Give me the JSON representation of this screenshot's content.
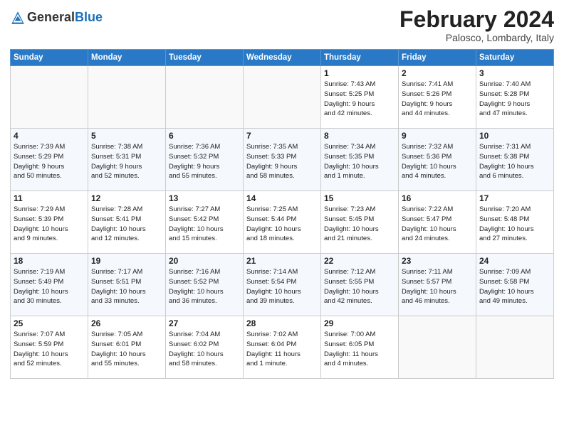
{
  "logo": {
    "general": "General",
    "blue": "Blue"
  },
  "header": {
    "month": "February 2024",
    "location": "Palosco, Lombardy, Italy"
  },
  "weekdays": [
    "Sunday",
    "Monday",
    "Tuesday",
    "Wednesday",
    "Thursday",
    "Friday",
    "Saturday"
  ],
  "weeks": [
    [
      {
        "day": "",
        "info": ""
      },
      {
        "day": "",
        "info": ""
      },
      {
        "day": "",
        "info": ""
      },
      {
        "day": "",
        "info": ""
      },
      {
        "day": "1",
        "info": "Sunrise: 7:43 AM\nSunset: 5:25 PM\nDaylight: 9 hours\nand 42 minutes."
      },
      {
        "day": "2",
        "info": "Sunrise: 7:41 AM\nSunset: 5:26 PM\nDaylight: 9 hours\nand 44 minutes."
      },
      {
        "day": "3",
        "info": "Sunrise: 7:40 AM\nSunset: 5:28 PM\nDaylight: 9 hours\nand 47 minutes."
      }
    ],
    [
      {
        "day": "4",
        "info": "Sunrise: 7:39 AM\nSunset: 5:29 PM\nDaylight: 9 hours\nand 50 minutes."
      },
      {
        "day": "5",
        "info": "Sunrise: 7:38 AM\nSunset: 5:31 PM\nDaylight: 9 hours\nand 52 minutes."
      },
      {
        "day": "6",
        "info": "Sunrise: 7:36 AM\nSunset: 5:32 PM\nDaylight: 9 hours\nand 55 minutes."
      },
      {
        "day": "7",
        "info": "Sunrise: 7:35 AM\nSunset: 5:33 PM\nDaylight: 9 hours\nand 58 minutes."
      },
      {
        "day": "8",
        "info": "Sunrise: 7:34 AM\nSunset: 5:35 PM\nDaylight: 10 hours\nand 1 minute."
      },
      {
        "day": "9",
        "info": "Sunrise: 7:32 AM\nSunset: 5:36 PM\nDaylight: 10 hours\nand 4 minutes."
      },
      {
        "day": "10",
        "info": "Sunrise: 7:31 AM\nSunset: 5:38 PM\nDaylight: 10 hours\nand 6 minutes."
      }
    ],
    [
      {
        "day": "11",
        "info": "Sunrise: 7:29 AM\nSunset: 5:39 PM\nDaylight: 10 hours\nand 9 minutes."
      },
      {
        "day": "12",
        "info": "Sunrise: 7:28 AM\nSunset: 5:41 PM\nDaylight: 10 hours\nand 12 minutes."
      },
      {
        "day": "13",
        "info": "Sunrise: 7:27 AM\nSunset: 5:42 PM\nDaylight: 10 hours\nand 15 minutes."
      },
      {
        "day": "14",
        "info": "Sunrise: 7:25 AM\nSunset: 5:44 PM\nDaylight: 10 hours\nand 18 minutes."
      },
      {
        "day": "15",
        "info": "Sunrise: 7:23 AM\nSunset: 5:45 PM\nDaylight: 10 hours\nand 21 minutes."
      },
      {
        "day": "16",
        "info": "Sunrise: 7:22 AM\nSunset: 5:47 PM\nDaylight: 10 hours\nand 24 minutes."
      },
      {
        "day": "17",
        "info": "Sunrise: 7:20 AM\nSunset: 5:48 PM\nDaylight: 10 hours\nand 27 minutes."
      }
    ],
    [
      {
        "day": "18",
        "info": "Sunrise: 7:19 AM\nSunset: 5:49 PM\nDaylight: 10 hours\nand 30 minutes."
      },
      {
        "day": "19",
        "info": "Sunrise: 7:17 AM\nSunset: 5:51 PM\nDaylight: 10 hours\nand 33 minutes."
      },
      {
        "day": "20",
        "info": "Sunrise: 7:16 AM\nSunset: 5:52 PM\nDaylight: 10 hours\nand 36 minutes."
      },
      {
        "day": "21",
        "info": "Sunrise: 7:14 AM\nSunset: 5:54 PM\nDaylight: 10 hours\nand 39 minutes."
      },
      {
        "day": "22",
        "info": "Sunrise: 7:12 AM\nSunset: 5:55 PM\nDaylight: 10 hours\nand 42 minutes."
      },
      {
        "day": "23",
        "info": "Sunrise: 7:11 AM\nSunset: 5:57 PM\nDaylight: 10 hours\nand 46 minutes."
      },
      {
        "day": "24",
        "info": "Sunrise: 7:09 AM\nSunset: 5:58 PM\nDaylight: 10 hours\nand 49 minutes."
      }
    ],
    [
      {
        "day": "25",
        "info": "Sunrise: 7:07 AM\nSunset: 5:59 PM\nDaylight: 10 hours\nand 52 minutes."
      },
      {
        "day": "26",
        "info": "Sunrise: 7:05 AM\nSunset: 6:01 PM\nDaylight: 10 hours\nand 55 minutes."
      },
      {
        "day": "27",
        "info": "Sunrise: 7:04 AM\nSunset: 6:02 PM\nDaylight: 10 hours\nand 58 minutes."
      },
      {
        "day": "28",
        "info": "Sunrise: 7:02 AM\nSunset: 6:04 PM\nDaylight: 11 hours\nand 1 minute."
      },
      {
        "day": "29",
        "info": "Sunrise: 7:00 AM\nSunset: 6:05 PM\nDaylight: 11 hours\nand 4 minutes."
      },
      {
        "day": "",
        "info": ""
      },
      {
        "day": "",
        "info": ""
      }
    ]
  ]
}
